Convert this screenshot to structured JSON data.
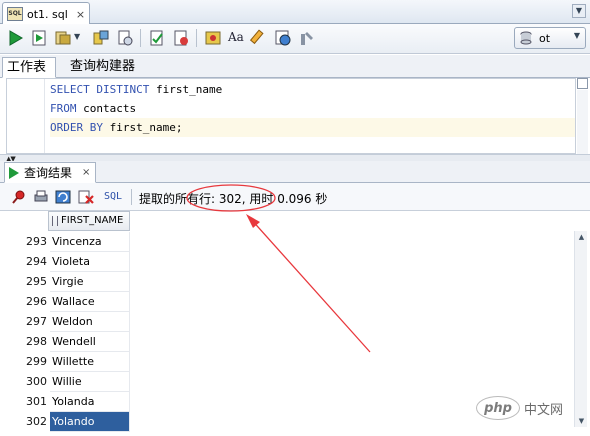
{
  "editor_tab": {
    "label": "ot1. sql",
    "icon_text": "SQL",
    "close": "×",
    "menu": "▼"
  },
  "toolbar": {
    "icons": [
      "run-statement-icon",
      "run-script-icon",
      "commit-icon",
      "dropdown-arrow-icon",
      "autotrace-icon",
      "explain-plan-icon",
      "commit-transaction-icon",
      "rollback-icon",
      "sql-tuning-icon",
      "uppercase-icon",
      "clear-icon",
      "history-icon",
      "tools-icon"
    ],
    "case_label": "Aa",
    "connection": {
      "value": "ot",
      "arrow": "▼",
      "icon": "database-icon"
    }
  },
  "worksheet_tabs": [
    {
      "label": "工作表"
    },
    {
      "label": "查询构建器"
    }
  ],
  "sql": {
    "line1_kw": "SELECT DISTINCT",
    "line1_rest": " first_name",
    "line2_kw": "FROM",
    "line2_rest": " contacts",
    "line3_kw": "ORDER BY",
    "line3_rest": " first_name;"
  },
  "results": {
    "tab_label": "查询结果",
    "tab_close": "×",
    "toolbar_icons": [
      "pin-icon",
      "print-icon",
      "refresh-icon",
      "cancel-icon"
    ],
    "sql_label": "SQL",
    "status": "提取的所有行: 302, 用时 0.096 秒",
    "column_header": "FIRST_NAME",
    "rows": [
      {
        "n": "293",
        "v": "Vincenza"
      },
      {
        "n": "294",
        "v": "Violeta"
      },
      {
        "n": "295",
        "v": "Virgie"
      },
      {
        "n": "296",
        "v": "Wallace"
      },
      {
        "n": "297",
        "v": "Weldon"
      },
      {
        "n": "298",
        "v": "Wendell"
      },
      {
        "n": "299",
        "v": "Willette"
      },
      {
        "n": "300",
        "v": "Willie"
      },
      {
        "n": "301",
        "v": "Yolanda"
      },
      {
        "n": "302",
        "v": "Yolando"
      }
    ],
    "selected_row": "302"
  },
  "watermark": {
    "logo": "php",
    "text": "中文网"
  },
  "colors": {
    "selection": "#2e5f9e",
    "keyword": "#3352b0",
    "annotation": "#e8383d",
    "run_green": "#1f9a3a"
  }
}
